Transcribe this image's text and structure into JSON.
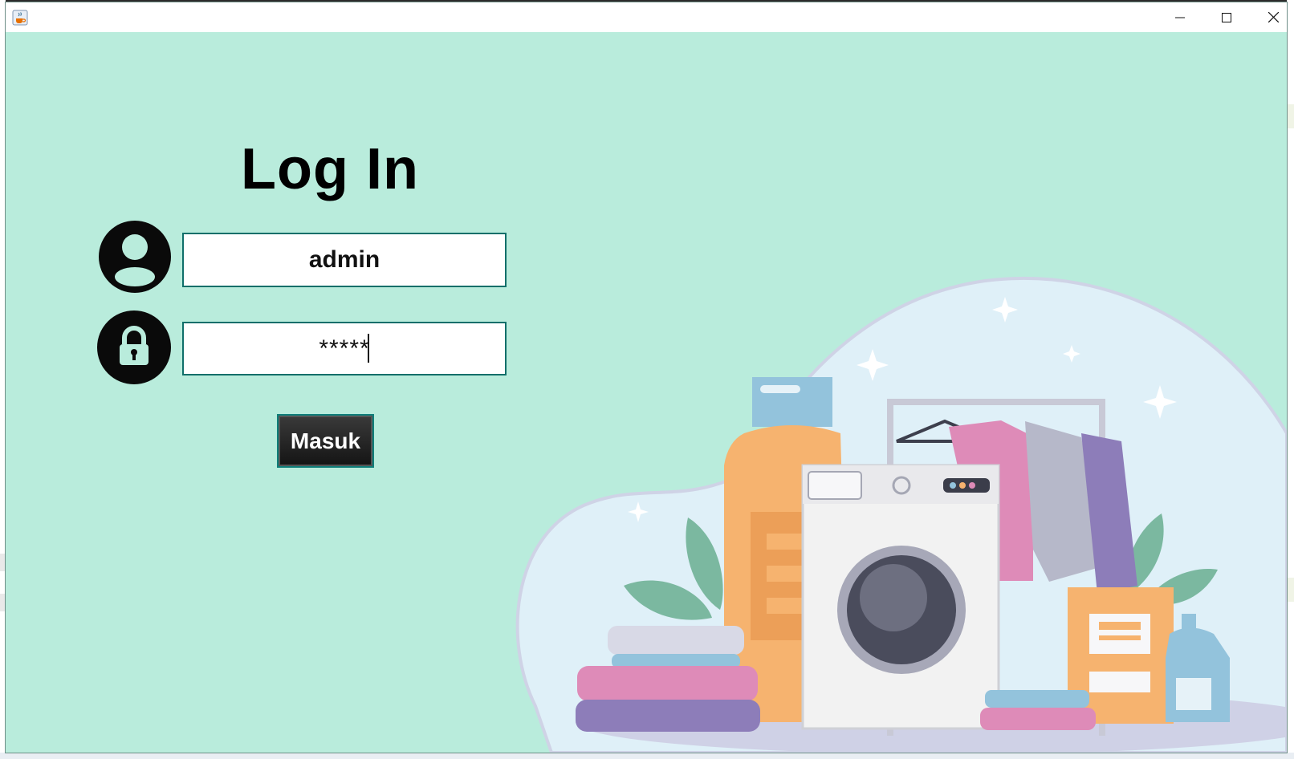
{
  "window": {
    "app_icon": "java-cup-icon",
    "controls": [
      "minimize-icon",
      "maximize-icon",
      "close-icon"
    ]
  },
  "login": {
    "title": "Log In",
    "username_value": "admin",
    "password_value": "*****",
    "submit_label": "Masuk",
    "user_icon": "user-icon",
    "lock_icon": "lock-icon"
  },
  "colors": {
    "background": "#b9ecdc",
    "field_border": "#0f6f6a",
    "button_bg": "#1f1f1f",
    "icon": "#0a0a0a"
  },
  "illustration": "laundry-illustration"
}
